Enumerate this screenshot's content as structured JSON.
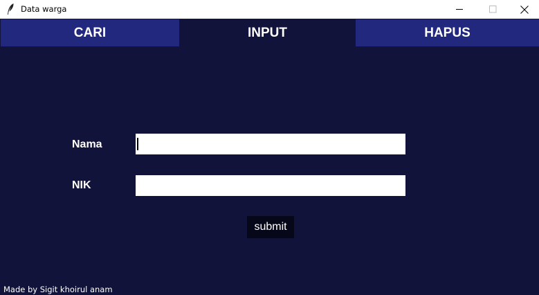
{
  "window": {
    "title": "Data warga",
    "icon": "feather-icon",
    "controls": [
      "minimize-icon",
      "maximize-icon",
      "close-icon"
    ]
  },
  "tabs": [
    {
      "label": "CARI",
      "active": false
    },
    {
      "label": "INPUT",
      "active": true
    },
    {
      "label": "HAPUS",
      "active": false
    }
  ],
  "form": {
    "nama_label": "Nama",
    "nama_value": "",
    "nik_label": "NIK",
    "nik_value": "",
    "submit_label": "submit"
  },
  "footer": {
    "credit": "Made by Sigit khoirul anam"
  },
  "colors": {
    "background": "#12133a",
    "tab_inactive": "#23287f",
    "tab_active": "#12133a",
    "button": "#07071a",
    "text": "#ffffff"
  }
}
